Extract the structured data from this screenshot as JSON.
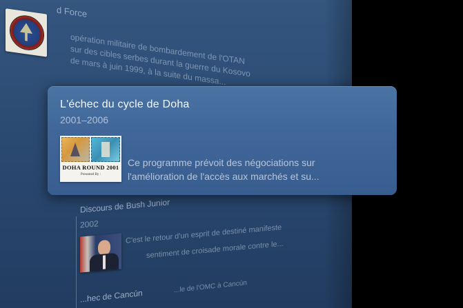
{
  "background_items": {
    "allied_force": {
      "title": "d Force",
      "description_lines": [
        "opération militaire de bombardement de l'OTAN",
        "sur des cibles serbes durant la guerre du Kosovo",
        "de mars à juin 1999, à la suite du massa..."
      ]
    },
    "bush_junior": {
      "title": "Discours de Bush Junior",
      "year": "2002",
      "description_line1": "C'est le retour d'un esprit de destiné manifeste",
      "description_line2": "sentiment de croisade morale contre le..."
    },
    "cancun": {
      "title": "...hec de Cancún",
      "description": "...le de l'OMC à Cancún"
    }
  },
  "popup": {
    "title": "L'échec du cycle de Doha",
    "year": "2001–2006",
    "thumbnail_caption": "DOHA ROUND 2001",
    "thumbnail_subcaption": "Presented By :",
    "description_lines": [
      "Ce programme prévoit des négociations sur",
      "l'amélioration de l'accès aux marchés et su..."
    ]
  }
}
